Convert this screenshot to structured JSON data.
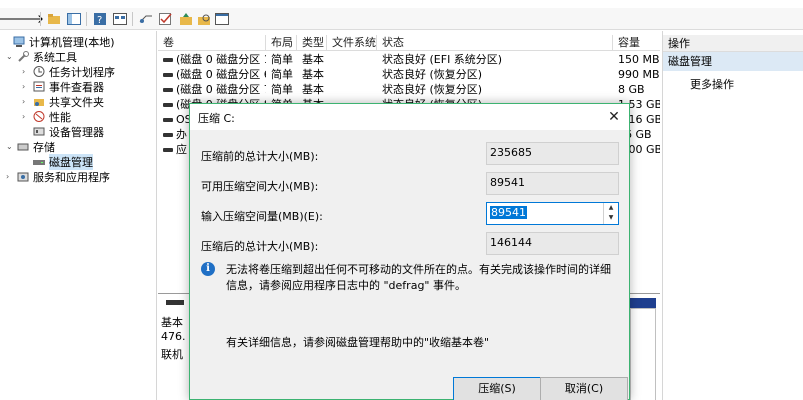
{
  "tree": {
    "items": [
      {
        "label": "计算机管理(本地)",
        "icon": "computer-icon"
      },
      {
        "label": "系统工具",
        "icon": "tools-icon"
      },
      {
        "label": "任务计划程序",
        "icon": "clock-icon"
      },
      {
        "label": "事件查看器",
        "icon": "event-viewer-icon"
      },
      {
        "label": "共享文件夹",
        "icon": "shared-folder-icon"
      },
      {
        "label": "性能",
        "icon": "performance-icon"
      },
      {
        "label": "设备管理器",
        "icon": "device-manager-icon"
      },
      {
        "label": "存储",
        "icon": "storage-icon"
      },
      {
        "label": "磁盘管理",
        "icon": "disk-icon"
      },
      {
        "label": "服务和应用程序",
        "icon": "services-icon"
      }
    ]
  },
  "grid": {
    "columns": [
      "卷",
      "布局",
      "类型",
      "文件系统",
      "状态",
      "容量"
    ],
    "rows": [
      {
        "vol": "(磁盘 0 磁盘分区 1)",
        "layout": "简单",
        "type": "基本",
        "fs": "",
        "status": "状态良好 (EFI 系统分区)",
        "cap": "150 MB"
      },
      {
        "vol": "(磁盘 0 磁盘分区 6)",
        "layout": "简单",
        "type": "基本",
        "fs": "",
        "status": "状态良好 (恢复分区)",
        "cap": "990 MB"
      },
      {
        "vol": "(磁盘 0 磁盘分区 7)",
        "layout": "简单",
        "type": "基本",
        "fs": "",
        "status": "状态良好 (恢复分区)",
        "cap": "8 GB"
      },
      {
        "vol": "(磁盘 0 磁盘分区 8)",
        "layout": "简单",
        "type": "基本",
        "fs": "",
        "status": "状态良好 (恢复分区)",
        "cap": "1.53 GB"
      },
      {
        "vol": "OS",
        "layout": "",
        "type": "",
        "fs": "",
        "status": "",
        "cap": "0.16 GB"
      },
      {
        "vol": "办",
        "layout": "",
        "type": "",
        "fs": "",
        "status": "",
        "cap": "66 GB"
      },
      {
        "vol": "应",
        "layout": "",
        "type": "",
        "fs": "",
        "status": "",
        "cap": "8.00 GB"
      }
    ]
  },
  "lower": {
    "disk_lines": [
      "基本",
      "476.",
      "联机"
    ]
  },
  "actions": {
    "header": "操作",
    "section": "磁盘管理",
    "more": "更多操作"
  },
  "dialog": {
    "title": "压缩 C:",
    "fields": [
      {
        "label": "压缩前的总计大小(MB):",
        "value": "235685"
      },
      {
        "label": "可用压缩空间大小(MB):",
        "value": "89541"
      },
      {
        "label": "输入压缩空间量(MB)(E):",
        "value": "89541"
      },
      {
        "label": "压缩后的总计大小(MB):",
        "value": "146144"
      }
    ],
    "info": "无法将卷压缩到超出任何不可移动的文件所在的点。有关完成该操作时间的详细信息，请参阅应用程序日志中的 \"defrag\" 事件。",
    "help": "有关详细信息，请参阅磁盘管理帮助中的\"收缩基本卷\"",
    "shrink_button": "压缩(S)",
    "cancel_button": "取消(C)"
  },
  "colors": {
    "dialog_border": "#3cb371",
    "accent": "#0078d7",
    "selection": "#cce4f7"
  }
}
